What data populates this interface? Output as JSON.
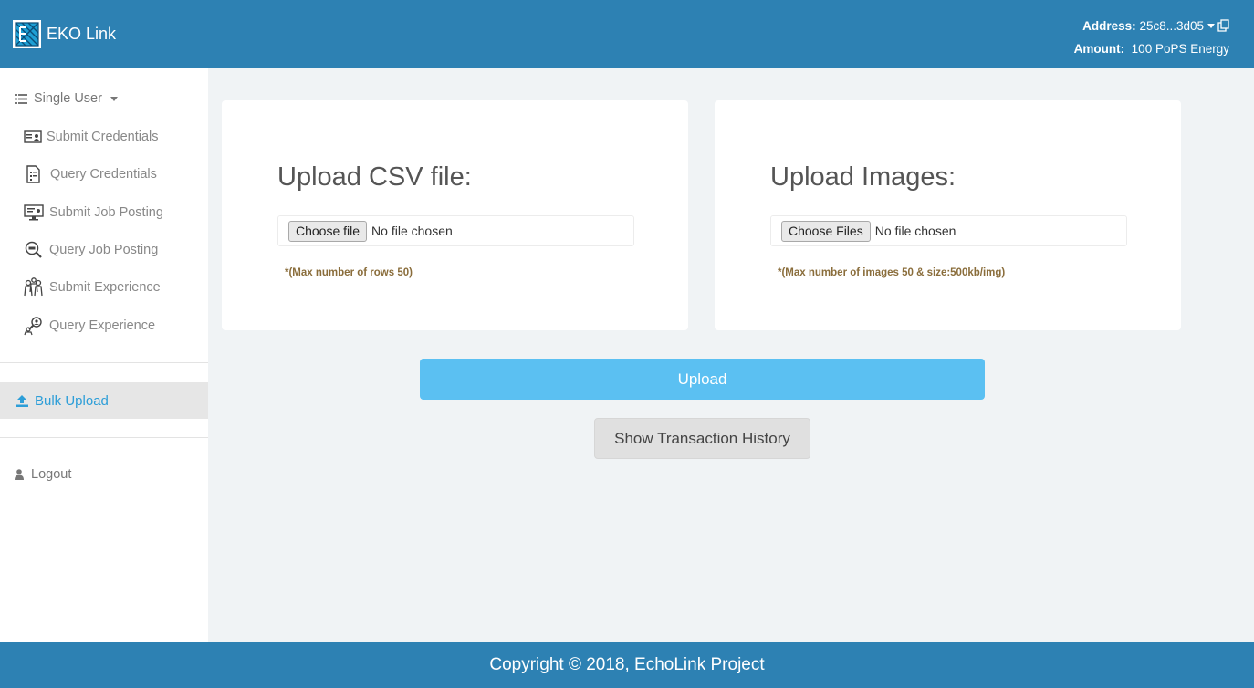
{
  "header": {
    "brand": "EKO Link",
    "logo_icon": "eko-logo-icon",
    "address_label": "Address:",
    "address_value": "25c8...3d05",
    "amount_label": "Amount:",
    "amount_value": "100 PoPS Energy"
  },
  "sidebar": {
    "group_label": "Single User",
    "items": [
      {
        "label": "Submit Credentials",
        "icon": "id-card-icon"
      },
      {
        "label": "Query Credentials",
        "icon": "document-icon"
      },
      {
        "label": "Submit Job Posting",
        "icon": "monitor-icon"
      },
      {
        "label": "Query Job Posting",
        "icon": "magnifier-icon"
      },
      {
        "label": "Submit Experience",
        "icon": "people-icon"
      },
      {
        "label": "Query Experience",
        "icon": "search-person-icon"
      }
    ],
    "active_label": "Bulk Upload",
    "logout_label": "Logout"
  },
  "main": {
    "csv": {
      "title": "Upload CSV file:",
      "button_label": "Choose file",
      "status": "No file chosen",
      "note": "*(Max number of rows 50)"
    },
    "images": {
      "title": "Upload Images:",
      "button_label": "Choose Files",
      "status": "No file chosen",
      "note": "*(Max number of images 50 & size:500kb/img)"
    },
    "upload_label": "Upload",
    "history_label": "Show Transaction History"
  },
  "footer": {
    "copyright": "Copyright © 2018, EchoLink Project"
  },
  "colors": {
    "header_bg": "#2d81b3",
    "upload_button": "#5bc0f2",
    "active_link": "#2d9ed8",
    "note_text": "#8a6d3b"
  }
}
